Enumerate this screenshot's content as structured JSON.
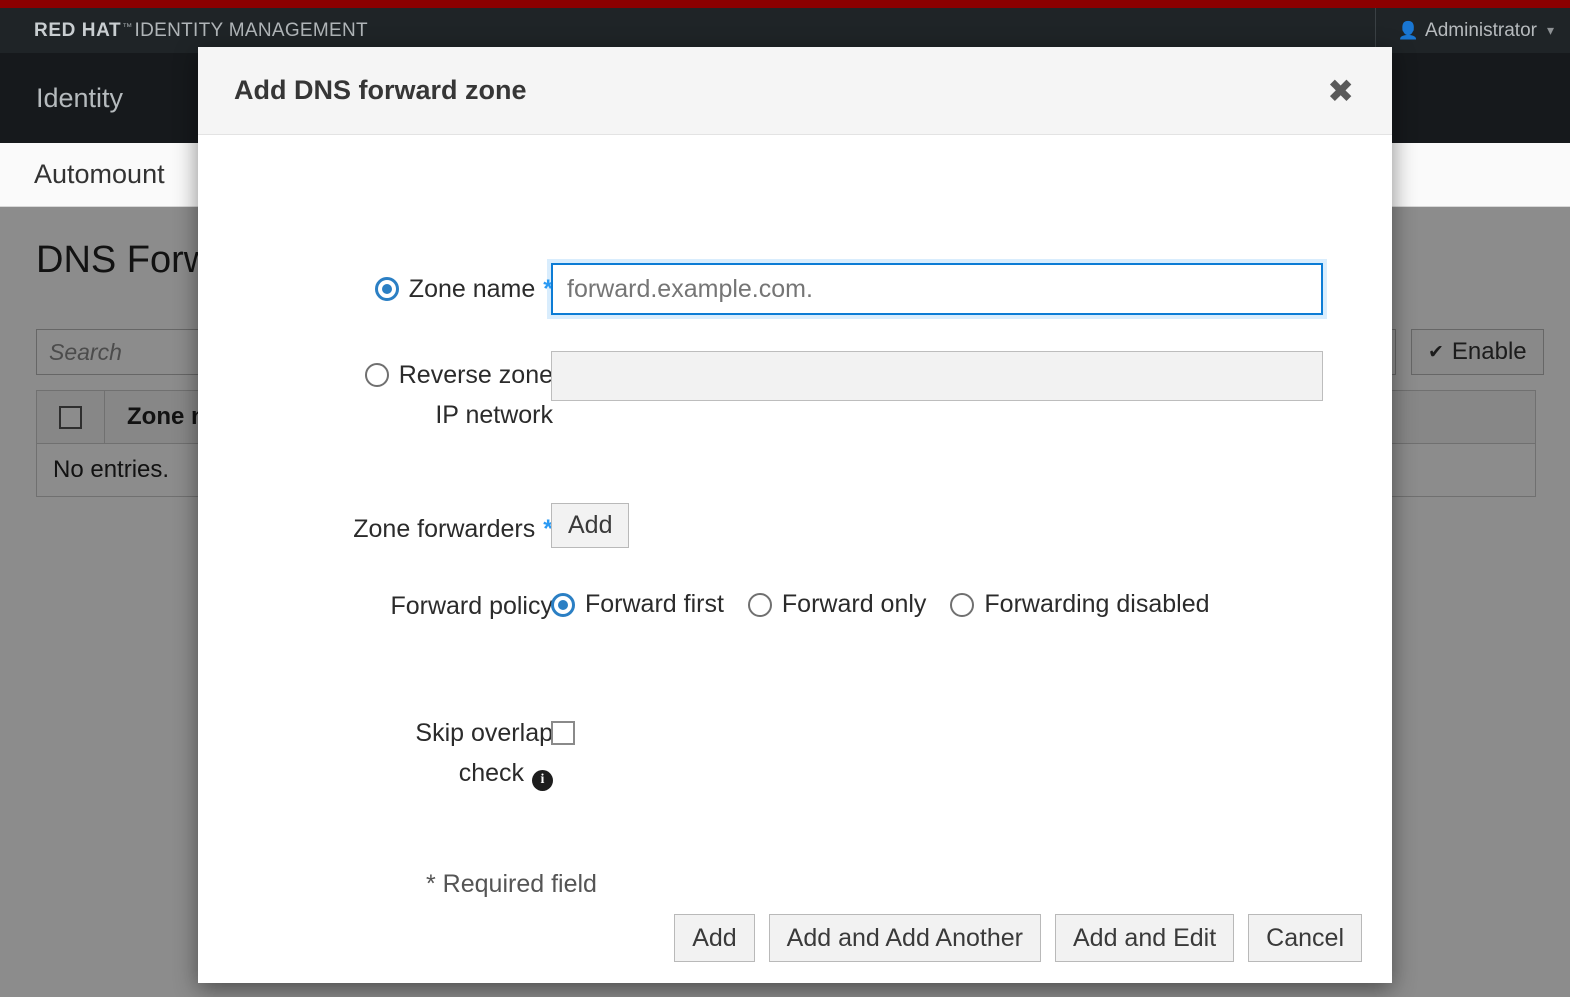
{
  "masthead": {
    "brand_strong": "RED HAT",
    "brand_tm": "™",
    "brand_rest": "IDENTITY MANAGEMENT",
    "user_icon": "user-icon",
    "username": "Administrator",
    "caret_icon": "chevron-down-icon",
    "accent_red": "#8b0000",
    "bar_bg": "#1f2427"
  },
  "nav": {
    "primary": [
      "Identity"
    ],
    "secondary": [
      "Automount"
    ]
  },
  "page": {
    "title": "DNS Forward Zones",
    "search_placeholder": "Search",
    "enable_label": "Enable",
    "enable_icon": "check-icon",
    "table": {
      "columns": [
        "",
        "Zone name"
      ],
      "empty_message": "No entries."
    }
  },
  "modal": {
    "title": "Add DNS forward zone",
    "close_icon": "close-icon",
    "fields": {
      "zone_name": {
        "label": "Zone name",
        "required_marker": "*",
        "radio_selected": true,
        "input_placeholder": "forward.example.com.",
        "input_value": ""
      },
      "reverse_zone": {
        "label_line1": "Reverse zone",
        "label_line2": "IP network",
        "radio_selected": false,
        "input_value": "",
        "disabled": true
      },
      "zone_forwarders": {
        "label": "Zone forwarders",
        "required_marker": "*",
        "add_label": "Add"
      },
      "forward_policy": {
        "label": "Forward policy",
        "options": [
          {
            "label": "Forward first",
            "selected": true
          },
          {
            "label": "Forward only",
            "selected": false
          },
          {
            "label": "Forwarding disabled",
            "selected": false
          }
        ]
      },
      "skip_overlap_check": {
        "label_line1": "Skip overlap",
        "label_line2": "check",
        "info_icon": "info-icon",
        "checked": false
      }
    },
    "required_note": "* Required field",
    "footer_buttons": [
      {
        "label": "Add",
        "name": "add-button"
      },
      {
        "label": "Add and Add Another",
        "name": "add-and-add-another-button"
      },
      {
        "label": "Add and Edit",
        "name": "add-and-edit-button"
      },
      {
        "label": "Cancel",
        "name": "cancel-button"
      }
    ]
  },
  "colors": {
    "accent_blue": "#2b7fc4",
    "focus_blue": "#0c7cd5",
    "required_blue": "#2b9af3",
    "brand_red": "#8b0000"
  }
}
